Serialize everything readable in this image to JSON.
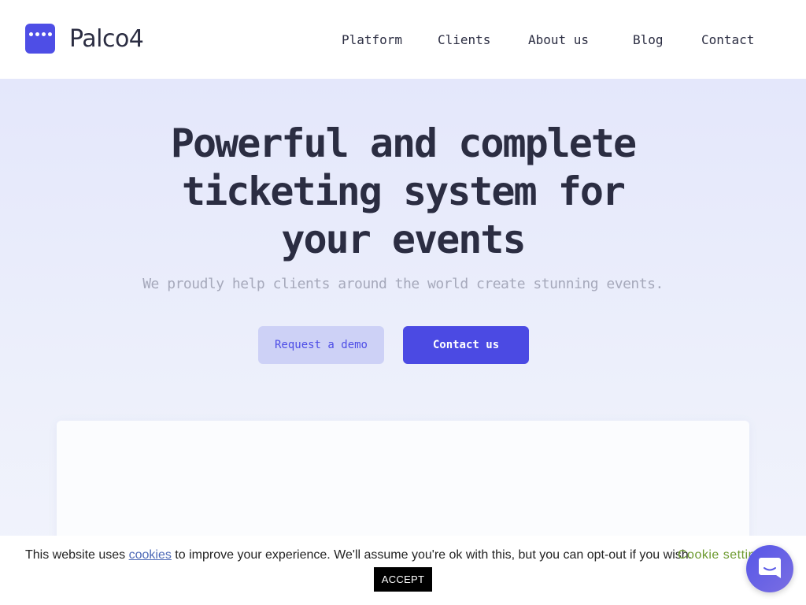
{
  "brand": {
    "name": "Palco4",
    "logo_icon": "ticket-dots-logo",
    "color": "#4e4ee6"
  },
  "nav": {
    "items": [
      {
        "label": "Platform"
      },
      {
        "label": "Clients"
      },
      {
        "label": "About us"
      },
      {
        "label": "Blog"
      },
      {
        "label": "Contact"
      }
    ]
  },
  "hero": {
    "title": "Powerful and complete ticketing system for your events",
    "subtitle": "We proudly help clients around the world create stunning events.",
    "demo_button": "Request a demo",
    "contact_button": "Contact us"
  },
  "cookie": {
    "text_before": "This website uses ",
    "link_text": "cookies",
    "text_after": " to improve your experience. We'll assume you're ok with this, but you can opt-out if you wish.",
    "settings_label": "Cookie settings",
    "accept_label": "ACCEPT"
  },
  "chat": {
    "icon": "chat-icon"
  },
  "colors": {
    "accent": "#4b4ae3",
    "hero_bg": "#e4e7fb",
    "cookie_settings": "#6c9a2e"
  }
}
